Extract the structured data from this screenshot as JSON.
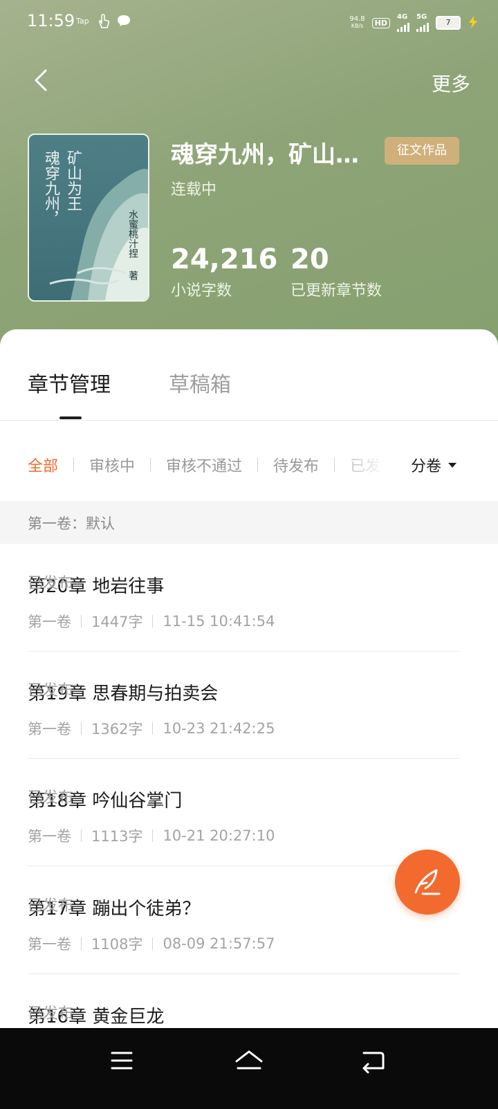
{
  "status_bar": {
    "time": "11:59",
    "tap_label": "Tap",
    "net_speed": "94.8",
    "net_unit": "KB/s",
    "hd_label": "HD",
    "sig1": "4G",
    "sig2": "5G",
    "battery": "7"
  },
  "header": {
    "more_label": "更多"
  },
  "book": {
    "title": "魂穿九州，矿山…",
    "badge": "征文作品",
    "state": "连载中",
    "cover_col1": "矿山为王",
    "cover_col2": "魂穿九州，",
    "cover_author": "水蜜桃汁捏",
    "cover_author_suffix": "著",
    "stats": [
      {
        "value": "24,216",
        "label": "小说字数"
      },
      {
        "value": "20",
        "label": "已更新章节数"
      }
    ]
  },
  "tabs": [
    {
      "label": "章节管理",
      "active": true
    },
    {
      "label": "草稿箱",
      "active": false
    }
  ],
  "filters": {
    "items": [
      "全部",
      "审核中",
      "审核不通过",
      "待发布",
      "已发"
    ],
    "active_index": 0,
    "volume_label": "分卷"
  },
  "volume_header": "第一卷：默认",
  "chapters": [
    {
      "title": "第20章 地岩往事",
      "volume": "第一卷",
      "words": "1447字",
      "time": "11-15 10:41:54",
      "status": "已发布"
    },
    {
      "title": "第19章 思春期与拍卖会",
      "volume": "第一卷",
      "words": "1362字",
      "time": "10-23 21:42:25",
      "status": "已发布"
    },
    {
      "title": "第18章 吟仙谷掌门",
      "volume": "第一卷",
      "words": "1113字",
      "time": "10-21 20:27:10",
      "status": "已发布"
    },
    {
      "title": "第17章 蹦出个徒弟？",
      "volume": "第一卷",
      "words": "1108字",
      "time": "08-09 21:57:57",
      "status": "已发布"
    },
    {
      "title": "第16章 黄金巨龙",
      "volume": "",
      "words": "",
      "time": "",
      "status": "已发布"
    }
  ],
  "colors": {
    "accent": "#f26a2e",
    "hero": "#8ea477",
    "badge": "#cfb07a"
  },
  "icons": {
    "back": "chevron-left-icon",
    "fab": "quill-pen-icon",
    "nav_menu": "menu-icon",
    "nav_home": "home-icon",
    "nav_back": "back-icon"
  }
}
